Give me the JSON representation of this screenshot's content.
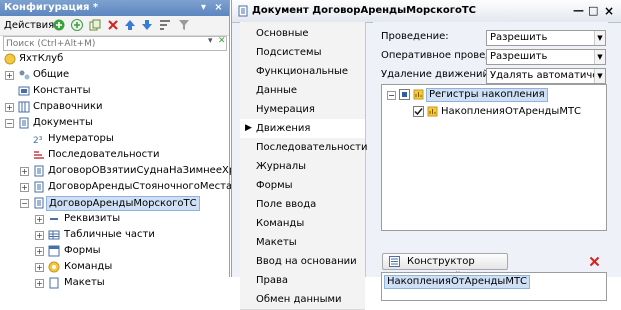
{
  "config_panel": {
    "title": "Конфигурация *",
    "title_buttons": [
      "▾",
      "×"
    ],
    "toolbar": {
      "actions_label": "Действия",
      "actions_arrow": "▾"
    },
    "search": {
      "placeholder": "Поиск (Ctrl+Alt+M)",
      "value": ""
    },
    "tree": [
      {
        "label": "ЯхтКлуб",
        "icon": "config-root-icon",
        "exp": ""
      },
      {
        "label": "Общие",
        "icon": "common-icon",
        "exp": "+"
      },
      {
        "label": "Константы",
        "icon": "constants-icon",
        "exp": ""
      },
      {
        "label": "Справочники",
        "icon": "catalogs-icon",
        "exp": "+"
      },
      {
        "label": "Документы",
        "icon": "documents-icon",
        "exp": "−"
      },
      {
        "label": "Нумераторы",
        "icon": "numerators-icon",
        "exp": ""
      },
      {
        "label": "Последовательности",
        "icon": "sequences-icon",
        "exp": ""
      },
      {
        "label": "ДоговорОВзятииСуднаНаЗимнееХранение",
        "icon": "document-icon",
        "exp": "+"
      },
      {
        "label": "ДоговорАрендыСтояночногоМестаПричала",
        "icon": "document-icon",
        "exp": "+"
      },
      {
        "label": "ДоговорАрендыМорскогоТС",
        "icon": "document-icon",
        "exp": "−"
      },
      {
        "label": "Реквизиты",
        "icon": "attributes-icon",
        "exp": "+"
      },
      {
        "label": "Табличные части",
        "icon": "tabular-sections-icon",
        "exp": "+"
      },
      {
        "label": "Формы",
        "icon": "forms-icon",
        "exp": "+"
      },
      {
        "label": "Команды",
        "icon": "commands-icon",
        "exp": "+"
      },
      {
        "label": "Макеты",
        "icon": "templates-icon",
        "exp": "+"
      }
    ]
  },
  "document_window": {
    "title": "Документ ДоговорАрендыМорскогоТС",
    "window_buttons": [
      "—",
      "□",
      "×"
    ],
    "tabs": [
      {
        "label": "Основные"
      },
      {
        "label": "Подсистемы"
      },
      {
        "label": "Функциональные опции"
      },
      {
        "label": "Данные"
      },
      {
        "label": "Нумерация"
      },
      {
        "label": "Движения",
        "active": true
      },
      {
        "label": "Последовательности"
      },
      {
        "label": "Журналы"
      },
      {
        "label": "Формы"
      },
      {
        "label": "Поле ввода"
      },
      {
        "label": "Команды"
      },
      {
        "label": "Макеты"
      },
      {
        "label": "Ввод на основании"
      },
      {
        "label": "Права"
      },
      {
        "label": "Обмен данными"
      }
    ],
    "posting": {
      "label": "Проведение:",
      "value": "Разрешить"
    },
    "realtime_posting": {
      "label": "Оперативное проведение:",
      "value": "Разрешить"
    },
    "delete_movements": {
      "label": "Удаление движений:",
      "value": "Удалять автоматически п"
    },
    "registers": {
      "group_label": "Регистры накопления",
      "items": [
        {
          "label": "НакопленияОтАрендыМТС",
          "checked": true
        }
      ]
    },
    "constructor_button": "Конструктор движений",
    "constructor_list": [
      "НакопленияОтАрендыМТС"
    ]
  },
  "colors": {
    "title_bar": "#5d85bf",
    "selection": "#cfe0f5",
    "panel_bg": "#eef2f8",
    "delete_red": "#d9201c"
  }
}
